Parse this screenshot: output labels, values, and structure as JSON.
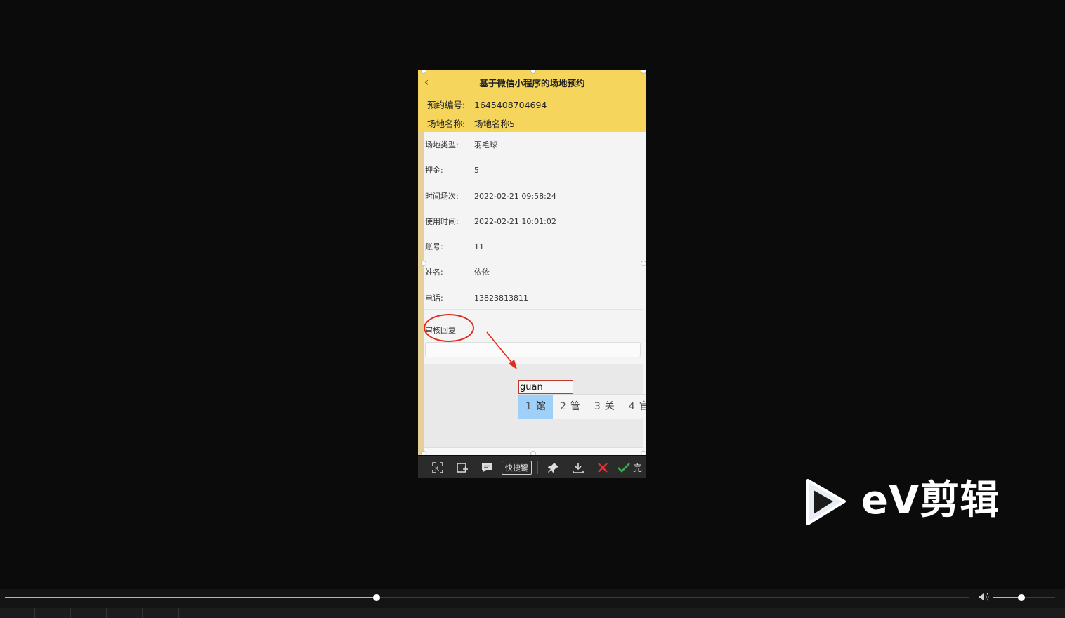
{
  "app": {
    "title": "基于微信小程序的场地预约",
    "back_icon": "‹"
  },
  "header_fields": [
    {
      "label": "预约编号:",
      "value": "1645408704694"
    },
    {
      "label": "场地名称:",
      "value": "场地名称5"
    }
  ],
  "fields": [
    {
      "label": "场地类型:",
      "value": "羽毛球"
    },
    {
      "label": "押金:",
      "value": "5"
    },
    {
      "label": "时间场次:",
      "value": "2022-02-21 09:58:24"
    },
    {
      "label": "使用时间:",
      "value": "2022-02-21 10:01:02"
    },
    {
      "label": "账号:",
      "value": "11"
    },
    {
      "label": "姓名:",
      "value": "依依"
    },
    {
      "label": "电话:",
      "value": "13823813811"
    }
  ],
  "reply": {
    "label": "审核回复",
    "value": ""
  },
  "ime": {
    "composition": "guan",
    "candidates": [
      {
        "num": "1",
        "char": "馆",
        "selected": true
      },
      {
        "num": "2",
        "char": "管",
        "selected": false
      },
      {
        "num": "3",
        "char": "关",
        "selected": false
      },
      {
        "num": "4",
        "char": "官",
        "selected": false
      }
    ]
  },
  "toolbar": {
    "shortcut_label": "快捷键",
    "complete_label": "完",
    "icons": [
      "long-screenshot-icon",
      "add-frame-icon",
      "comment-icon",
      "pin-icon",
      "download-icon",
      "cancel-icon",
      "confirm-icon"
    ]
  },
  "logo": {
    "text": "eV剪辑",
    "colors": {
      "play": "#d8e0f0"
    }
  },
  "player": {
    "progress": 0.385,
    "volume": 0.45,
    "accent": "#e8b81f"
  }
}
